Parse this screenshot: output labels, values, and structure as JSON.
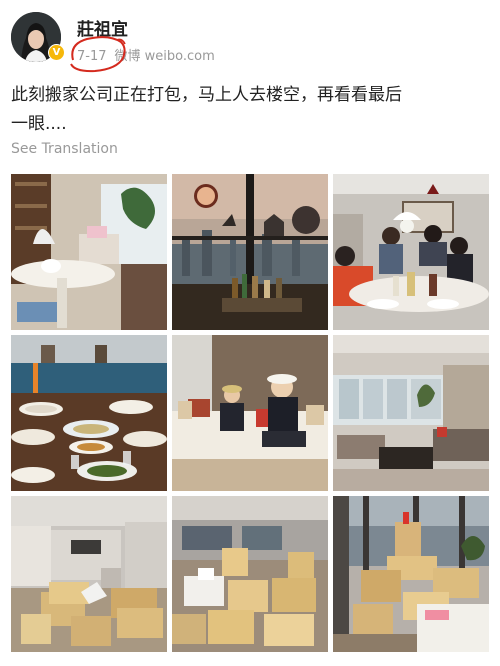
{
  "user": {
    "name": "莊祖宜",
    "verified_badge": "V"
  },
  "post": {
    "date": "7-17",
    "source": "微博 weibo.com",
    "text_line1": "此刻搬家公司正在打包，马上人去楼空，再看看最后",
    "text_line2": "一眼....",
    "see_translation": "See Translation"
  },
  "photos": [
    {
      "icon": "living-room-table-photo"
    },
    {
      "icon": "window-skyline-photo"
    },
    {
      "icon": "family-dinner-photo"
    },
    {
      "icon": "dining-table-photo"
    },
    {
      "icon": "children-on-sofa-photo"
    },
    {
      "icon": "living-room-sofa-photo"
    },
    {
      "icon": "packing-boxes-room-photo"
    },
    {
      "icon": "packing-boxes-kitchen-photo"
    },
    {
      "icon": "packing-boxes-window-photo"
    }
  ],
  "colors": {
    "annotation_red": "#d42a1e",
    "badge_yellow": "#f6b80a",
    "meta_gray": "#999999"
  }
}
